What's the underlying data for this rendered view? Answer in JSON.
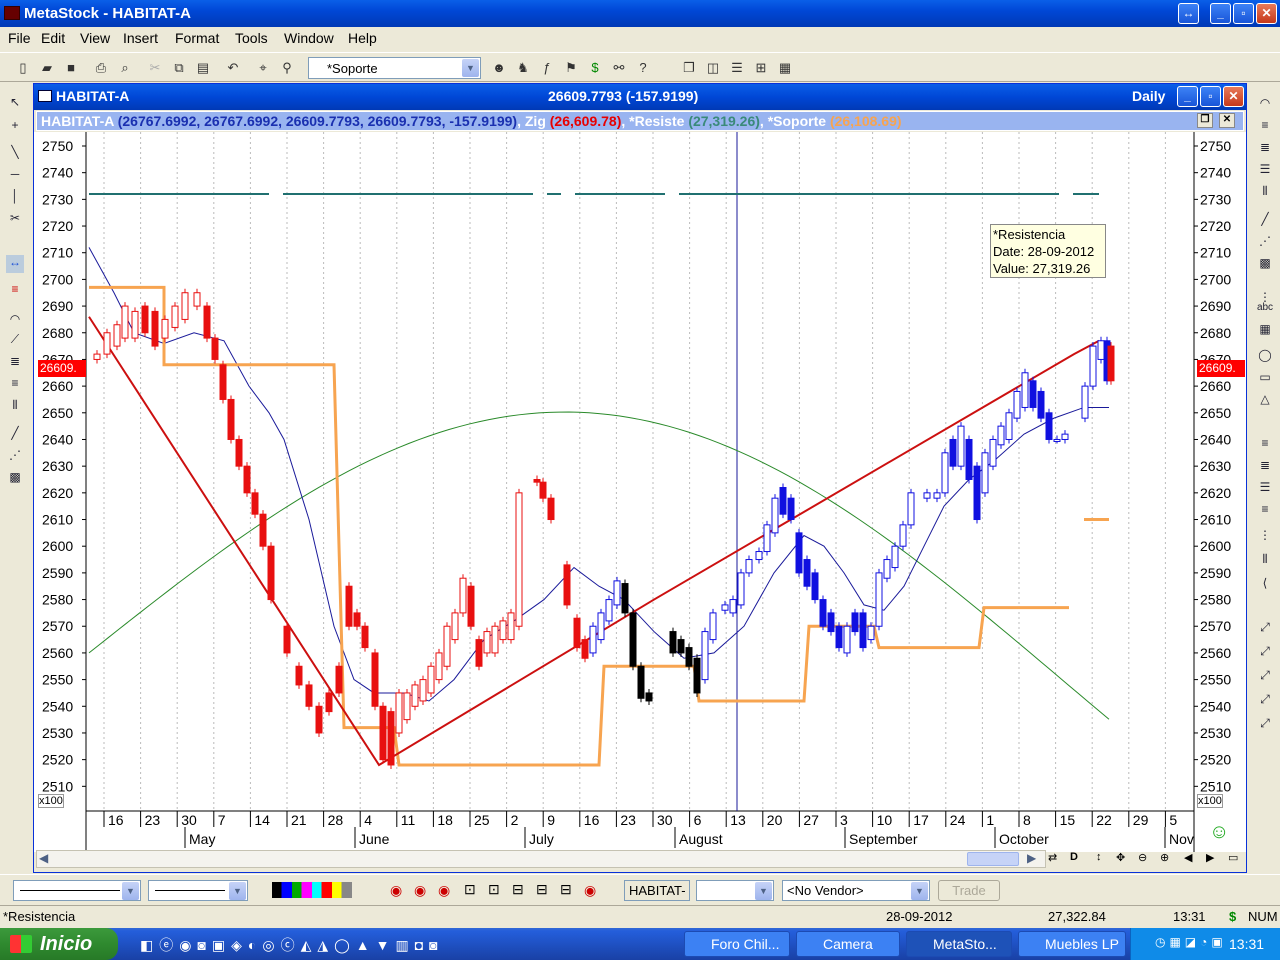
{
  "app": {
    "title": "MetaStock - HABITAT-A"
  },
  "menu": [
    "File",
    "Edit",
    "View",
    "Insert",
    "Format",
    "Tools",
    "Window",
    "Help"
  ],
  "toolbar": {
    "combo_value": "*Soporte"
  },
  "chart_window": {
    "title": "HABITAT-A",
    "center_value": "26609.7793 (-157.9199)",
    "period": "Daily"
  },
  "legend": {
    "sym": "HABITAT-A",
    "ohlc": "(26767.6992, 26767.6992, 26609.7793, 26609.7793, -157.9199)",
    "zig_label": ", Zig",
    "zig_value": "(26,609.78)",
    "res_label": ", *Resiste",
    "res_value": "(27,319.26)",
    "sop_label": ", *Soporte",
    "sop_value": "(26,108.69)"
  },
  "tooltip": {
    "line1": "*Resistencia",
    "line2": "Date: 28-09-2012",
    "line3": "Value: 27,319.26"
  },
  "price_marker": "26609.",
  "scale_multiplier": "x100",
  "bottom": {
    "symbol_box": "HABITAT-",
    "vendor": "<No Vendor>",
    "trade_btn": "Trade"
  },
  "status": {
    "left": "*Resistencia",
    "date": "28-09-2012",
    "value": "27,322.84",
    "time": "13:31",
    "currency": "$",
    "num": "NUM"
  },
  "taskbar": {
    "start": "Inicio",
    "tasks": [
      "Foro Chil...",
      "Camera",
      "MetaSto...",
      "Muebles LP"
    ],
    "clock": "13:31"
  },
  "chart_data": {
    "type": "candlestick",
    "title": "HABITAT-A",
    "ylim": [
      2500,
      2750
    ],
    "yticks": [
      2750,
      2740,
      2730,
      2720,
      2710,
      2700,
      2690,
      2680,
      2670,
      2660,
      2650,
      2640,
      2630,
      2620,
      2610,
      2600,
      2590,
      2580,
      2570,
      2560,
      2550,
      2540,
      2530,
      2520,
      2510
    ],
    "day_labels": [
      "16",
      "23",
      "30",
      "7",
      "14",
      "21",
      "28",
      "4",
      "11",
      "18",
      "25",
      "2",
      "9",
      "16",
      "23",
      "30",
      "6",
      "13",
      "20",
      "27",
      "3",
      "10",
      "17",
      "24",
      "1",
      "8",
      "15",
      "22",
      "29",
      "5"
    ],
    "month_labels": [
      "May",
      "June",
      "July",
      "August",
      "September",
      "October",
      "Nov"
    ],
    "colors": {
      "down": "#e81010",
      "up_bear": "#000000",
      "blue": "#1010e0",
      "soporte": "#f7a450",
      "resist": "#207070",
      "zig": "#cc1010",
      "ma_short": "#1a1a9a",
      "ma_long": "#2a8a2a"
    },
    "resistencia_level": 2732,
    "soporte": [
      [
        2696,
        2697
      ],
      [
        2668,
        2668
      ],
      [
        2532,
        2532
      ],
      [
        2517,
        2517
      ],
      [
        2555,
        2555
      ],
      [
        2542,
        2542
      ],
      [
        2570,
        2570
      ],
      [
        2562,
        2562
      ],
      [
        2577,
        2577
      ]
    ],
    "zig": [
      [
        2686,
        2518,
        2663,
        2677
      ]
    ]
  }
}
